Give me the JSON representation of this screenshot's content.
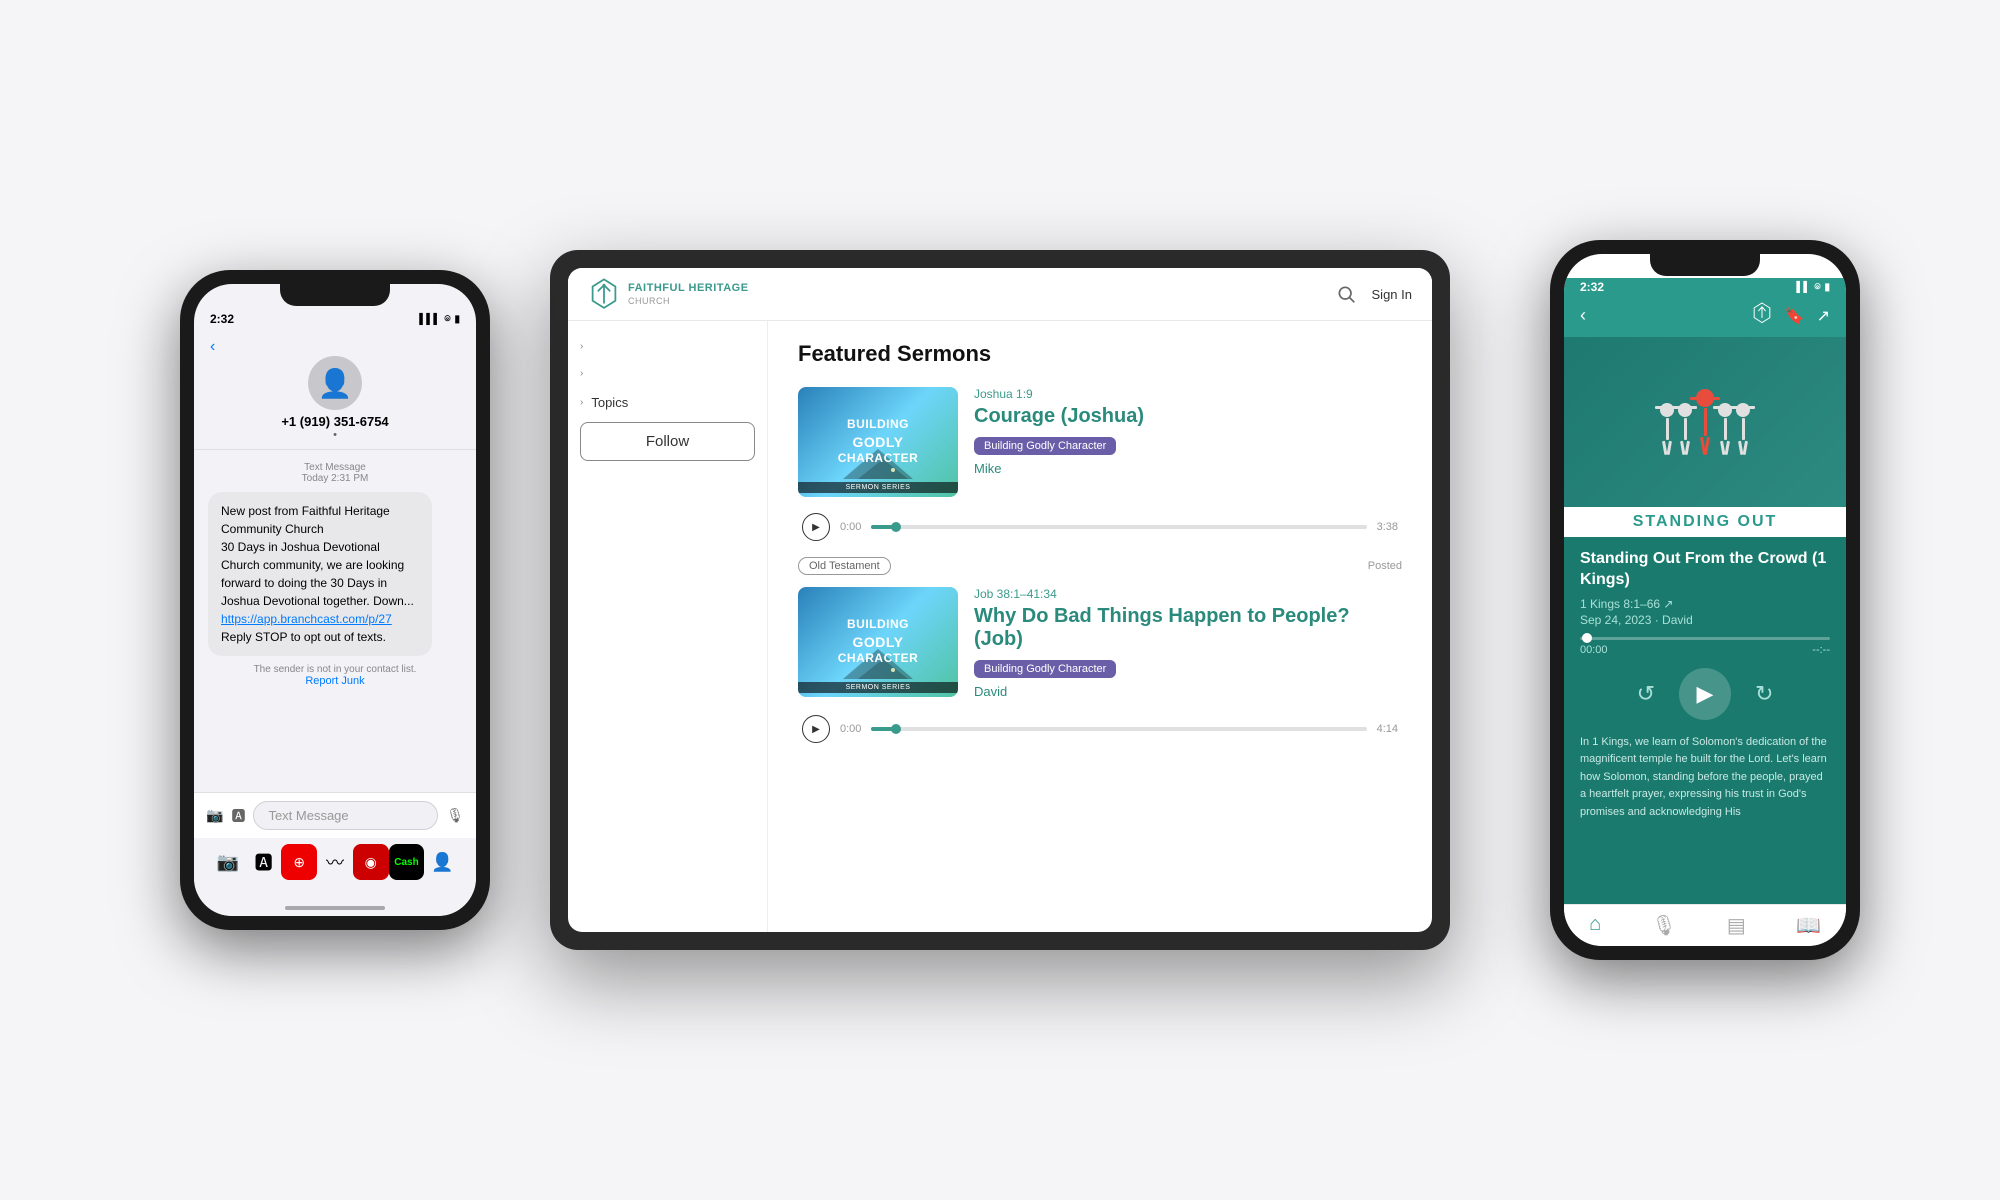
{
  "scene": {
    "background": "#f5f5f7"
  },
  "tablet": {
    "logo_text": "FAITHFUL HERITAGE",
    "logo_subtext": "CHURCH",
    "sign_in_label": "Sign In",
    "featured_title": "Featured Sermons",
    "sidebar_items": [
      {
        "chevron": "›",
        "label": ""
      },
      {
        "chevron": "›",
        "label": ""
      },
      {
        "chevron": "›",
        "label": "Topics"
      }
    ],
    "follow_btn": "Follow",
    "sermon1": {
      "ref": "Joshua 1:9",
      "title": "Courage (Joshua)",
      "tag": "Building Godly Character",
      "speaker": "Mike",
      "time_start": "0:00",
      "time_end": "3:38",
      "progress": "5%"
    },
    "sermon2": {
      "ref": "Job 38:1–41:34",
      "title": "Why Do Bad Things Happen to People? (Job)",
      "tag": "Building Godly Character",
      "speaker": "David",
      "time_start": "0:00",
      "time_end": "4:14",
      "progress": "5%",
      "category": "Old Testament",
      "posted": "Posted"
    }
  },
  "phone_left": {
    "status_time": "2:32",
    "status_signal": "●●●",
    "status_wifi": "WiFi",
    "status_battery": "🔋",
    "contact_number": "+1 (919) 351-6754",
    "contact_sub": "•",
    "message_date": "Text Message",
    "message_subdate": "Today 2:31 PM",
    "sms_text": "New post from Faithful Heritage Community Church\n30 Days in Joshua Devotional\nChurch community, we are looking forward to doing the 30 Days in Joshua Devotional together. Down...",
    "sms_link": "https://app.branchcast.com/p/27",
    "sms_link_suffix": "\nReply STOP to opt out of texts.",
    "not_in_contacts": "The sender is not in your contact list.",
    "report_junk": "Report Junk",
    "input_placeholder": "Text Message",
    "dock_icons": [
      "📷",
      "🅰",
      "🔴",
      "〰",
      "🔴",
      "💰",
      "👤"
    ]
  },
  "phone_right": {
    "status_time": "2:32",
    "sermon_title": "Standing Out From the Crowd (1 Kings)",
    "ref": "1 Kings 8:1–66 ↗",
    "date_speaker": "Sep 24, 2023 · David",
    "artwork_title": "STANDING OUT",
    "time_current": "00:00",
    "time_total": "--:--",
    "description": "In 1 Kings, we learn of Solomon's dedication of the magnificent temple he built for the Lord. Let's learn how Solomon, standing before the people, prayed a heartfelt prayer, expressing his trust in God's promises and acknowledging His",
    "nav": [
      "🏠",
      "🎙",
      "📋",
      "📖"
    ]
  }
}
